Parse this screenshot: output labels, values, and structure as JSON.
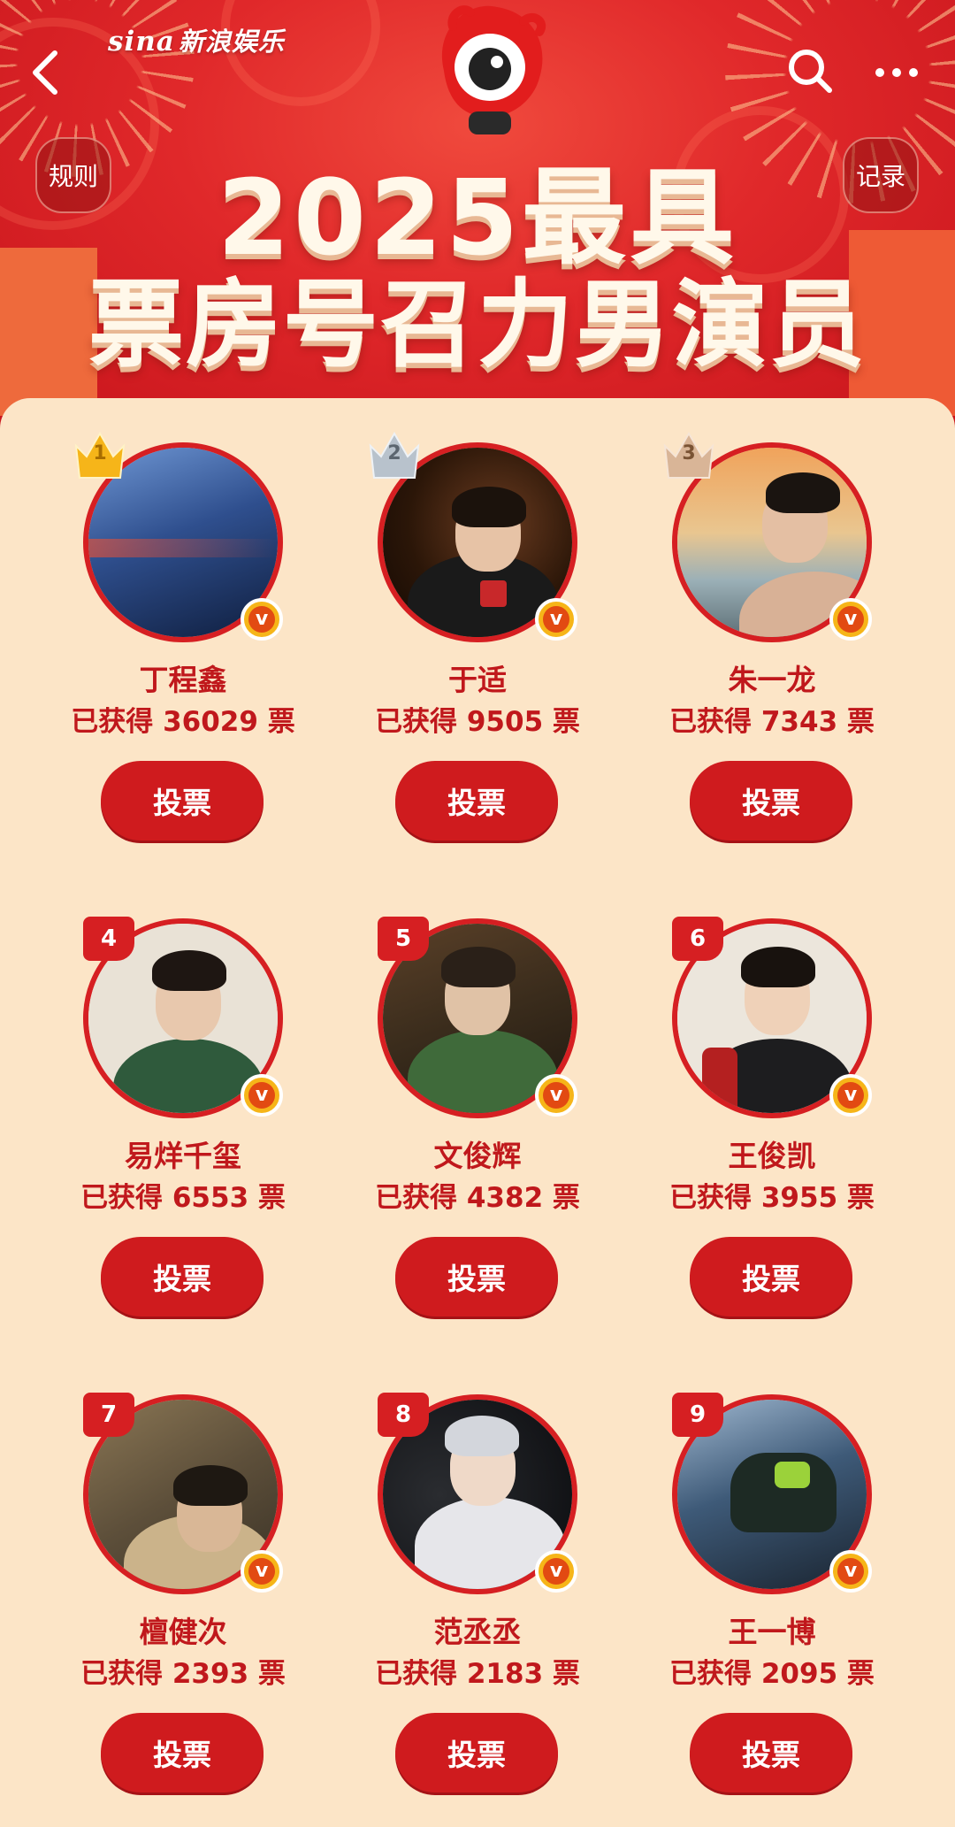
{
  "header": {
    "logo_sina": "sina",
    "logo_text": "新浪娱乐",
    "rules_label": "规则",
    "record_label": "记录",
    "title_line1": "2025最具",
    "title_line2": "票房号召力男演员"
  },
  "colors": {
    "primary_red": "#d61f22",
    "panel_bg": "#fce5c7",
    "gold_badge": "#f6b519",
    "silver_badge": "#b8c2cc",
    "bronze_badge": "#d9b597"
  },
  "icons": {
    "back": "chevron-left-icon",
    "search": "search-icon",
    "more": "more-dots-icon",
    "verified": "verified-v-icon",
    "crown": "crown-badge-icon"
  },
  "candidates": [
    {
      "rank": "1",
      "name": "丁程鑫",
      "votes": "已获得 36029 票",
      "vote_label": "投票"
    },
    {
      "rank": "2",
      "name": "于适",
      "votes": "已获得 9505 票",
      "vote_label": "投票"
    },
    {
      "rank": "3",
      "name": "朱一龙",
      "votes": "已获得 7343 票",
      "vote_label": "投票"
    },
    {
      "rank": "4",
      "name": "易烊千玺",
      "votes": "已获得 6553 票",
      "vote_label": "投票"
    },
    {
      "rank": "5",
      "name": "文俊辉",
      "votes": "已获得 4382 票",
      "vote_label": "投票"
    },
    {
      "rank": "6",
      "name": "王俊凯",
      "votes": "已获得 3955 票",
      "vote_label": "投票"
    },
    {
      "rank": "7",
      "name": "檀健次",
      "votes": "已获得 2393 票",
      "vote_label": "投票"
    },
    {
      "rank": "8",
      "name": "范丞丞",
      "votes": "已获得 2183 票",
      "vote_label": "投票"
    },
    {
      "rank": "9",
      "name": "王一博",
      "votes": "已获得 2095 票",
      "vote_label": "投票"
    }
  ]
}
